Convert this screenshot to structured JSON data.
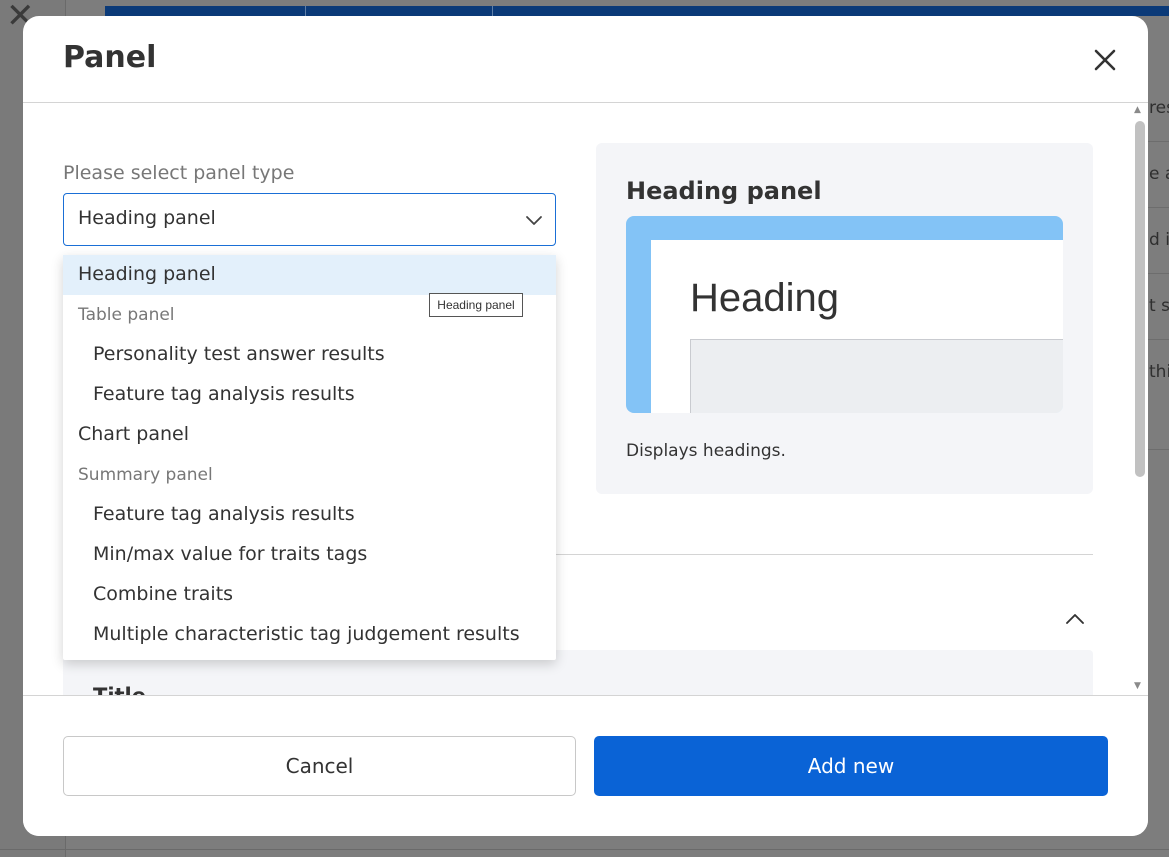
{
  "modal": {
    "title": "Panel",
    "close_icon": "close-icon"
  },
  "form": {
    "label": "Please select panel type",
    "selected": "Heading panel"
  },
  "dropdown": {
    "options": [
      {
        "kind": "option",
        "label": "Heading panel",
        "selected": true
      },
      {
        "kind": "group",
        "label": "Table panel"
      },
      {
        "kind": "option",
        "label": "Personality test answer results",
        "indent": true
      },
      {
        "kind": "option",
        "label": "Feature tag analysis results",
        "indent": true
      },
      {
        "kind": "option",
        "label": "Chart panel"
      },
      {
        "kind": "group",
        "label": "Summary panel"
      },
      {
        "kind": "option",
        "label": "Feature tag analysis results",
        "indent": true
      },
      {
        "kind": "option",
        "label": "Min/max value for traits tags",
        "indent": true
      },
      {
        "kind": "option",
        "label": "Combine traits",
        "indent": true
      },
      {
        "kind": "option",
        "label": "Multiple characteristic tag judgement results",
        "indent": true
      }
    ],
    "tooltip": "Heading panel"
  },
  "preview": {
    "title": "Heading panel",
    "image_heading": "Heading",
    "description": "Displays headings."
  },
  "section": {
    "title": "Title"
  },
  "footer": {
    "cancel_label": "Cancel",
    "add_label": "Add new"
  },
  "background": {
    "snippets": [
      "res",
      "e a",
      "d is",
      "t sh",
      "thi"
    ]
  },
  "colors": {
    "primary": "#0a63d6",
    "select_border": "#1a6fd6",
    "selected_option_bg": "#e3f0fb",
    "preview_bg": "#f4f5f8",
    "preview_accent": "#83c3f6"
  }
}
